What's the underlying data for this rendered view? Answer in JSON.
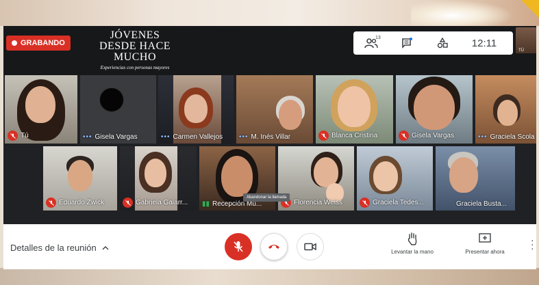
{
  "branding": {
    "line1": "JÓVENES",
    "line2": "DESDE HACE MUCHO",
    "tagline": "Experiencias con personas mayores"
  },
  "recording": {
    "label": "GRABANDO",
    "color": "#d93025"
  },
  "top_info": {
    "participants_count": "13",
    "time": "12:11",
    "self_label": "TÚ"
  },
  "participants_row1": [
    {
      "name": "Tú",
      "status": "muted"
    },
    {
      "name": "Gisela Vargas",
      "status": "speaking-dots"
    },
    {
      "name": "Carmen Vallejos",
      "status": "speaking-dots"
    },
    {
      "name": "M. Inés Villar",
      "status": "speaking-dots"
    },
    {
      "name": "Blanca Cristina",
      "status": "muted"
    },
    {
      "name": "Gisela Vargas",
      "status": "muted"
    },
    {
      "name": "Graciela Scola",
      "status": "speaking-dots"
    }
  ],
  "participants_row2": [
    {
      "name": "Eduardo Zwick",
      "status": "muted"
    },
    {
      "name": "Gabriela Galarr...",
      "status": "muted"
    },
    {
      "name": "Recepción Mu...",
      "status": "audio-bars"
    },
    {
      "name": "Florencia Weiss",
      "status": "muted"
    },
    {
      "name": "Graciela Tedes...",
      "status": "muted"
    },
    {
      "name": "Graciela Busta...",
      "status": "none"
    }
  ],
  "bottom": {
    "meeting_details": "Detalles de la reunión",
    "hangup_tooltip": "Abandonar la llamada",
    "raise_hand": "Levantar la mano",
    "present_now": "Presentar ahora"
  },
  "icons": {
    "participants": "people-icon",
    "chat": "chat-icon",
    "activities": "shapes-icon",
    "mic_off": "mic-off-icon",
    "hangup": "phone-hangup-icon",
    "camera": "camera-icon",
    "hand": "hand-icon",
    "present": "present-screen-icon",
    "more": "more-vert-icon"
  },
  "colors": {
    "accent_red": "#d93025",
    "speaking_blue": "#8ab4f8",
    "audio_green": "#34a853"
  }
}
